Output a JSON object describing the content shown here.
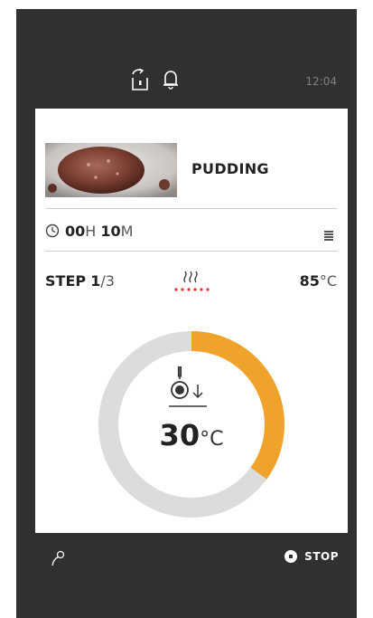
{
  "status_bar": {
    "time": "12:04",
    "icons": [
      "door-lock-icon",
      "bell-icon"
    ]
  },
  "recipe": {
    "name": "PUDDING",
    "image": "pudding-photo"
  },
  "timer": {
    "hours": "00",
    "hours_unit": "H",
    "minutes": "10",
    "minutes_unit": "M",
    "icon": "clock-icon",
    "menu_icon": "list-icon"
  },
  "step": {
    "label": "STEP",
    "current": "1",
    "total": "/3",
    "heat_icon": "steam-heat-icon",
    "setpoint_value": "85",
    "setpoint_unit": "°C"
  },
  "core_probe": {
    "icon": "core-probe-icon",
    "value": "30",
    "unit": "°C",
    "progress_fraction": 0.35,
    "colors": {
      "progress": "#f0a32a",
      "track": "#dcdcdc"
    }
  },
  "bottom_bar": {
    "left_icon": "pin-icon",
    "stop_label": "STOP"
  }
}
